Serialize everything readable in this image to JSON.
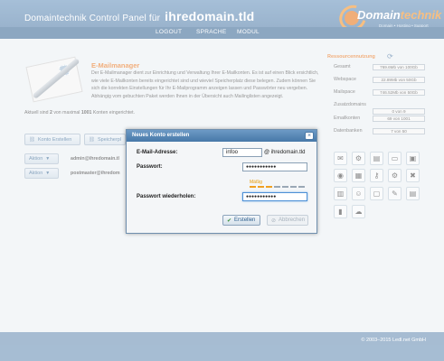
{
  "header": {
    "title_prefix": "Domaintechnik Control Panel für",
    "title_domain": "ihredomain.tld",
    "logo_brand_a": "Domain",
    "logo_brand_b": "technik",
    "logo_tagline": "Domain • Hosting • Support"
  },
  "nav": {
    "items": [
      "LOGOUT",
      "SPRACHE",
      "MODUL"
    ]
  },
  "page": {
    "title": "E-Mailmanager",
    "description": "Der E-Mailmanager dient zur Einrichtung und Verwaltung Ihrer E-Mailkonten. Es ist auf einen Blick ersichtlich, wie viele E-Mailkonten bereits eingerichtet sind und wieviel Speicherplatz diese belegen. Zudem können Sie sich die korrekten Einstellungen für Ihr E-Mailprogramm anzeigen lassen und Passwörter neu vergeben. Abhängig vom gebuchten Paket werden Ihnen in der Übersicht auch Mailinglisten angezeigt.",
    "summary_a": "Aktuell sind",
    "summary_count": "2",
    "summary_b": "von maximal",
    "summary_max": "1001",
    "summary_c": "Konten eingerichtet."
  },
  "resources": {
    "title": "Ressourcennutzung",
    "rows": [
      {
        "label": "Gesamt",
        "value": "769.6Mb von 100Gb",
        "fraction": 0.008
      },
      {
        "label": "Webspace",
        "value": "22.89Mb von 50Gb",
        "fraction": 0.0005
      },
      {
        "label": "Mailspace",
        "value": "746.52Mb von 50Gb",
        "fraction": 0.015
      },
      {
        "label": "Zusatzdomains",
        "value": "0 von 9",
        "fraction": 0
      },
      {
        "label": "Emailkonten",
        "value": "69 von 1001",
        "fraction": 0.07
      },
      {
        "label": "Datenbanken",
        "value": "7 von 50",
        "fraction": 0.14
      }
    ]
  },
  "toolbar": {
    "create_label": "Konto Erstellen",
    "storage_label": "Speicherpl"
  },
  "accounts": [
    {
      "action": "Aktion",
      "email": "admin@ihredomain.tl"
    },
    {
      "action": "Aktion",
      "email": "postmaster@ihredom"
    }
  ],
  "modal": {
    "title": "Neues Konto erstellen",
    "close": "×",
    "email_label": "E-Mail-Adresse:",
    "email_value": "infoo",
    "email_suffix": "@ ihredomain.tld",
    "password_label": "Passwort:",
    "password_value": "●●●●●●●●●●●",
    "strength_label": "Mäßig",
    "repeat_label": "Passwort wiederholen:",
    "repeat_value": "●●●●●●●●●●●",
    "create_button": "Erstellen",
    "cancel_button": "Abbrechen"
  },
  "footer": {
    "text": "© 2003–2015 Ledl.net GmbH"
  },
  "colors": {
    "accent": "#e86d12",
    "primary": "#3f6d9c"
  }
}
